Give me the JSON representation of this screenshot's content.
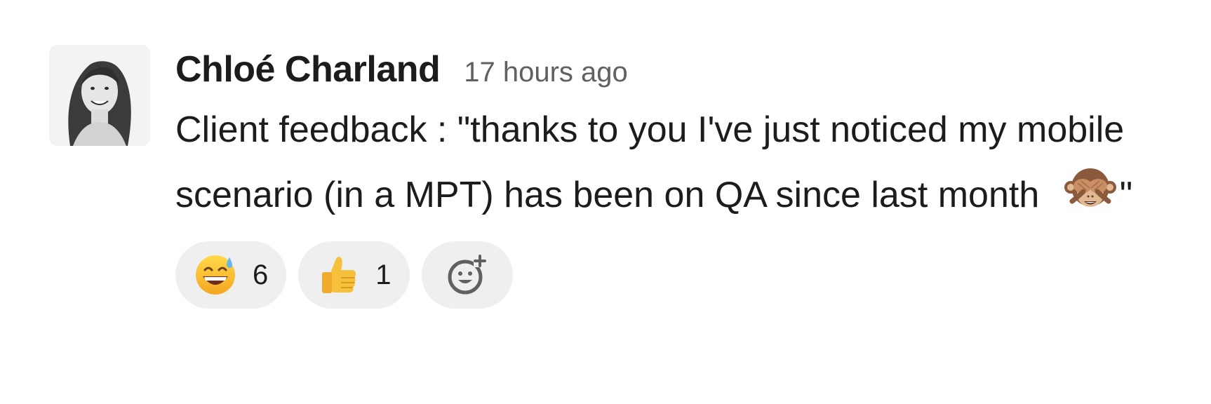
{
  "message": {
    "author": "Chloé Charland",
    "timestamp": "17 hours ago",
    "text_before_emoji": "Client feedback :  \"thanks to you I've just noticed my mobile scenario (in a MPT) has been on QA since last month",
    "inline_emoji": "see-no-evil-monkey",
    "text_after_emoji": "\"",
    "avatar_icon": "user-photo-avatar"
  },
  "reactions": [
    {
      "emoji": "grinning-face-with-sweat",
      "count": "6"
    },
    {
      "emoji": "thumbs-up",
      "count": "1"
    }
  ],
  "add_reaction": {
    "icon": "add-reaction-icon"
  },
  "colors": {
    "text": "#1d1c1d",
    "muted": "#616061",
    "reaction_bg": "#efefef"
  }
}
